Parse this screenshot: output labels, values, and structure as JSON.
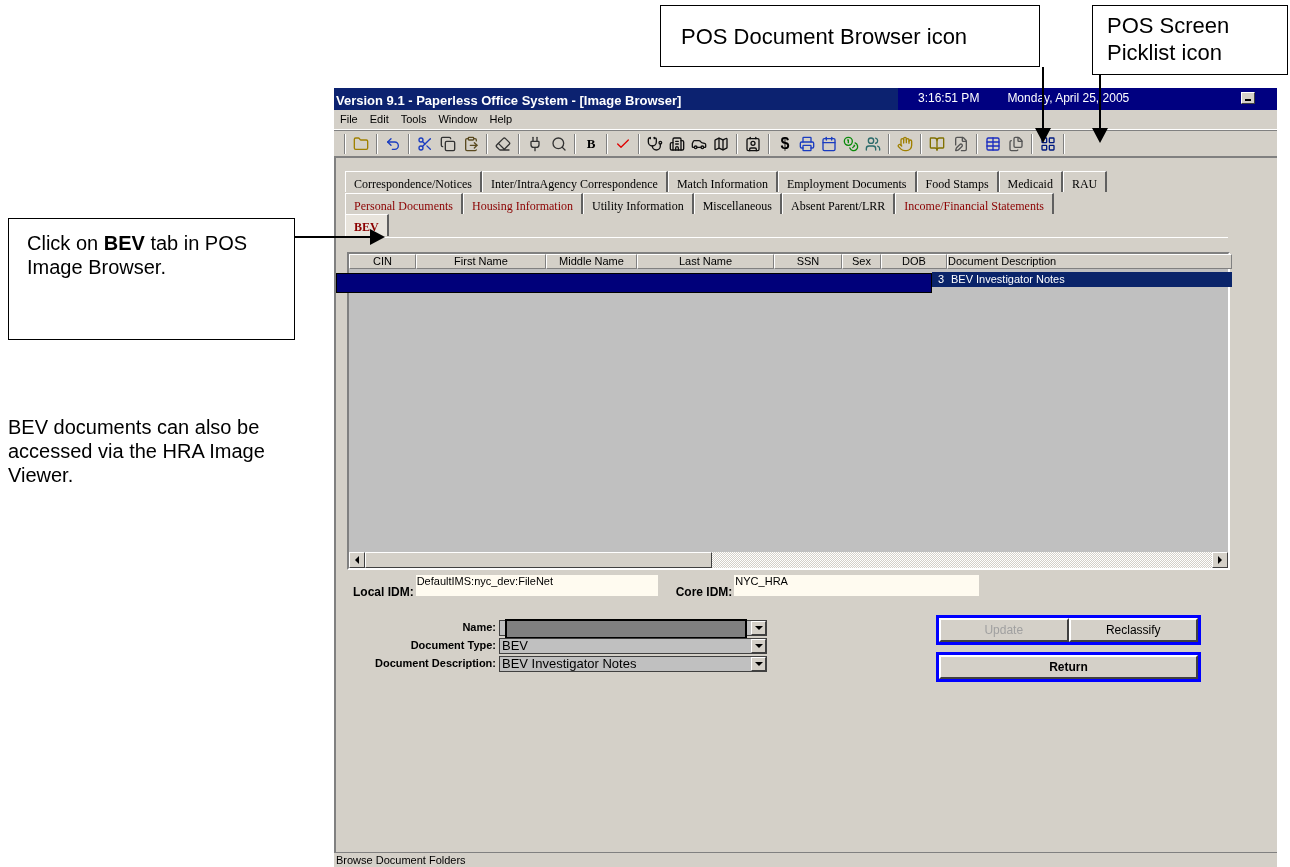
{
  "callouts": {
    "top": [
      "POS Document Browser icon",
      "POS Screen Picklist icon"
    ],
    "left": "Click on **BEV** tab in POS Image Browser.",
    "note": "BEV documents can also be accessed via the HRA Image Viewer."
  },
  "window": {
    "title": "Version 9.1 - Paperless Office System - [Image Browser]",
    "time": "3:16:51 PM",
    "date": "Monday, April 25, 2005"
  },
  "menu": [
    "File",
    "Edit",
    "Tools",
    "Window",
    "Help"
  ],
  "toolbar": {
    "bold_button": "B",
    "dollar_button": "$"
  },
  "tab_rows": [
    [
      {
        "label": "Correspondence/Notices",
        "selected": false,
        "highlighted": false
      },
      {
        "label": "Inter/IntraAgency Correspondence",
        "selected": false,
        "highlighted": false
      },
      {
        "label": "Match Information",
        "selected": false,
        "highlighted": false
      },
      {
        "label": "Employment Documents",
        "selected": false,
        "highlighted": false
      },
      {
        "label": "Food Stamps",
        "selected": false,
        "highlighted": false
      },
      {
        "label": "Medicaid",
        "selected": false,
        "highlighted": false
      },
      {
        "label": "RAU",
        "selected": false,
        "highlighted": false
      }
    ],
    [
      {
        "label": "Personal Documents",
        "selected": false,
        "highlighted": true
      },
      {
        "label": "Housing Information",
        "selected": false,
        "highlighted": true
      },
      {
        "label": "Utility Information",
        "selected": false,
        "highlighted": false
      },
      {
        "label": "Miscellaneous",
        "selected": false,
        "highlighted": false
      },
      {
        "label": "Absent Parent/LRR",
        "selected": false,
        "highlighted": false
      },
      {
        "label": "Income/Financial Statements",
        "selected": false,
        "highlighted": true
      }
    ],
    [
      {
        "label": "BEV",
        "selected": true,
        "highlighted": true
      }
    ]
  ],
  "table": {
    "columns": [
      "CIN",
      "First Name",
      "Middle Name",
      "Last Name",
      "SSN",
      "Sex",
      "DOB",
      "Document Description"
    ],
    "rows": [
      {
        "selected": true,
        "redacted": true,
        "dob": "3",
        "document_description": "BEV Investigator Notes"
      }
    ]
  },
  "idm": {
    "local_label": "Local IDM:",
    "local_value": "DefaultIMS:nyc_dev:FileNet",
    "core_label": "Core IDM:",
    "core_value": "NYC_HRA"
  },
  "form": [
    {
      "label": "Name:",
      "kind": "redacted"
    },
    {
      "label": "Document Type:",
      "kind": "text",
      "value": "BEV"
    },
    {
      "label": "Document Description:",
      "kind": "text",
      "value": "BEV Investigator Notes"
    }
  ],
  "buttons": [
    [
      {
        "label": "Update",
        "disabled": true
      },
      {
        "label": "Reclassify",
        "disabled": false
      }
    ],
    [
      {
        "label": "Return",
        "disabled": false
      }
    ]
  ],
  "status_bar": "Browse Document Folders"
}
